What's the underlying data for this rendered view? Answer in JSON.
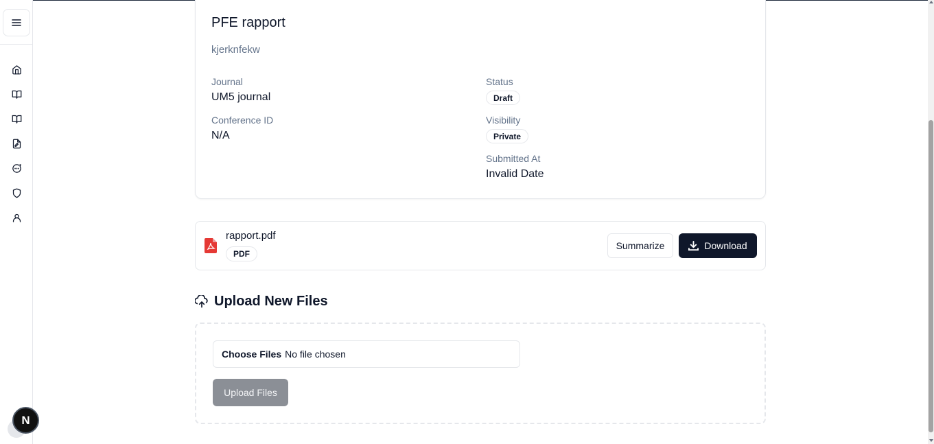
{
  "sidebar": {
    "toggle": {
      "icon": "panel-toggle-icon"
    },
    "items": [
      {
        "icon": "home-icon"
      },
      {
        "icon": "book-open-icon"
      },
      {
        "icon": "book-open-icon"
      },
      {
        "icon": "file-edit-icon"
      },
      {
        "icon": "message-circle-icon"
      },
      {
        "icon": "shield-icon"
      },
      {
        "icon": "user-icon"
      }
    ],
    "badge_letter": "N"
  },
  "paper": {
    "title": "PFE rapport",
    "subtitle": "kjerknfekw",
    "journal_label": "Journal",
    "journal_value": "UM5 journal",
    "conference_label": "Conference ID",
    "conference_value": "N/A",
    "status_label": "Status",
    "status_value": "Draft",
    "visibility_label": "Visibility",
    "visibility_value": "Private",
    "submitted_label": "Submitted At",
    "submitted_value": "Invalid Date"
  },
  "file": {
    "name": "rapport.pdf",
    "type": "PDF",
    "summarize_label": "Summarize",
    "download_label": "Download"
  },
  "upload": {
    "heading": "Upload New Files",
    "choose_label": "Choose Files",
    "no_file_text": "No file chosen",
    "button_label": "Upload Files"
  },
  "colors": {
    "primary": "#0f172a",
    "muted": "#64748b",
    "border": "#e5e7eb",
    "pdf_red": "#e53935",
    "disabled_button": "#8b8f96"
  }
}
